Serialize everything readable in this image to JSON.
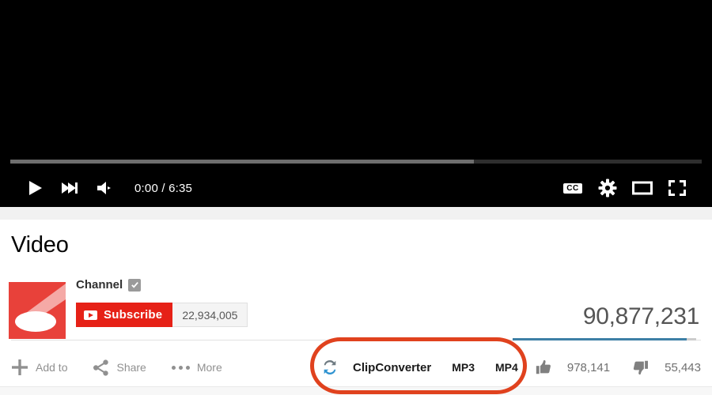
{
  "player": {
    "time_display": "0:00 / 6:35",
    "current_time": "0:00",
    "duration": "6:35",
    "progress_played_percent": 0,
    "progress_loaded_percent": 67,
    "controls_left": [
      {
        "name": "play-button",
        "label": "Play"
      },
      {
        "name": "next-button",
        "label": "Next"
      },
      {
        "name": "volume-button",
        "label": "Volume"
      }
    ],
    "controls_right": [
      {
        "name": "captions-button",
        "label": "CC"
      },
      {
        "name": "settings-button",
        "label": "Settings"
      },
      {
        "name": "theater-button",
        "label": "Theater mode"
      },
      {
        "name": "fullscreen-button",
        "label": "Fullscreen"
      }
    ]
  },
  "video": {
    "title": "Video",
    "view_count": "90,877,231"
  },
  "channel": {
    "name": "Channel",
    "verified": true,
    "subscribe_label": "Subscribe",
    "subscriber_count": "22,934,005"
  },
  "actions": [
    {
      "icon": "plus-icon",
      "label": "Add to"
    },
    {
      "icon": "share-icon",
      "label": "Share"
    },
    {
      "icon": "more-dots-icon",
      "label": "More"
    }
  ],
  "clipconverter": {
    "name": "ClipConverter",
    "icon": "convert-arrows-icon",
    "formats": [
      {
        "label": "MP3"
      },
      {
        "label": "MP4"
      }
    ]
  },
  "ratings": {
    "likes": "978,141",
    "dislikes": "55,443",
    "like_ratio_percent": 95
  },
  "annotation": {
    "shape": "oval",
    "color": "#e0421e",
    "target": "clipconverter"
  },
  "colors": {
    "brand_red": "#e62117",
    "annotation_red": "#e0421e",
    "sentiment_blue": "#3d7fa6",
    "player_black": "#000000",
    "avatar_red": "#e8413a"
  }
}
